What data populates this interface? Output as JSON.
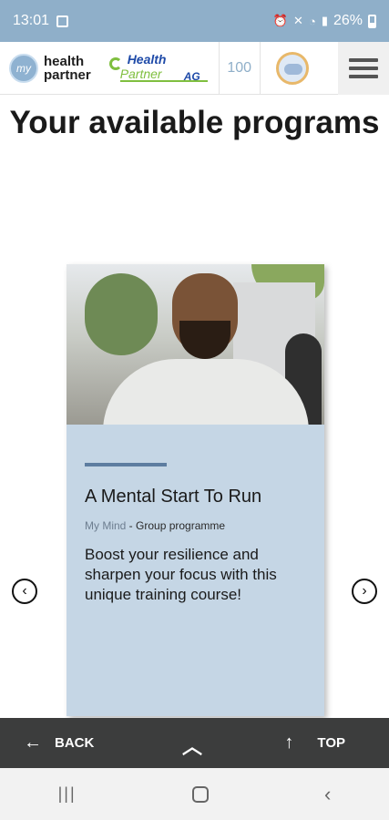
{
  "status_bar": {
    "time": "13:01",
    "battery": "26%"
  },
  "header": {
    "logo_my": "my",
    "logo_line1": "health",
    "logo_line2": "partner",
    "partner_health": "Health",
    "partner_partner": "Partner",
    "partner_ag": "AG",
    "score": "100"
  },
  "page": {
    "title": "Your available programs"
  },
  "card": {
    "title": "A Mental Start To Run",
    "category": "My Mind",
    "separator": " - ",
    "type": "Group programme",
    "description": "Boost your resilience and sharpen your focus with this unique training course!"
  },
  "nav_arrows": {
    "prev_icon": "chevron-left-icon",
    "next_icon": "chevron-right-icon"
  },
  "action_bar": {
    "back_label": "BACK",
    "top_label": "TOP"
  },
  "colors": {
    "status_bar": "#8fafc9",
    "card_bg": "#c5d6e5",
    "action_bar": "#3c3d3d",
    "accent_rule": "#5d7da0"
  }
}
